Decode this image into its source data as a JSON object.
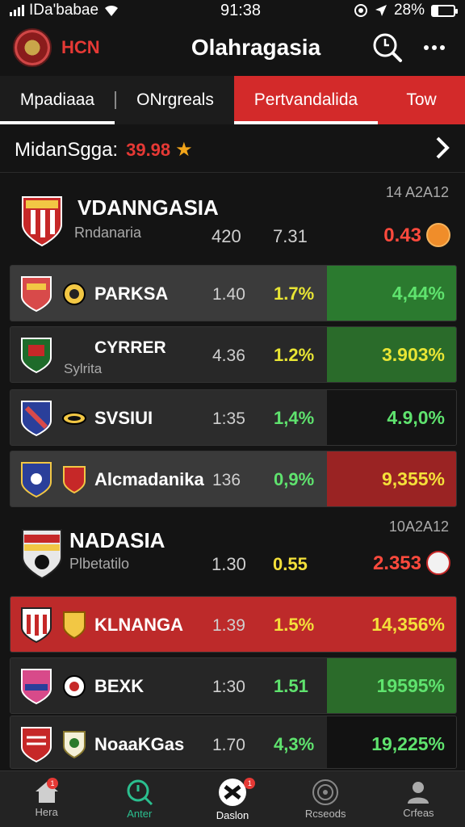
{
  "status": {
    "carrier": "IDa'babae",
    "time": "91:38",
    "battery": "28%",
    "battery_level": 0.28
  },
  "header": {
    "brand": "HCN",
    "title": "Olahragasia"
  },
  "tabs": [
    {
      "label": "Mpadiaaa",
      "active": true
    },
    {
      "label": "ONrgreals",
      "active": false
    },
    {
      "label": "Pertvandalida",
      "active": true
    },
    {
      "label": "Tow",
      "active": false
    }
  ],
  "filter": {
    "label": "MidanSgga:",
    "value": "39.98"
  },
  "groups": [
    {
      "name": "VDANNGASIA",
      "sub": "Rndanaria",
      "date": "14 A2A12",
      "c1": "420",
      "c2": "7.31",
      "c3": "0.43"
    },
    {
      "name": "NADASIA",
      "sub": "Plbetatilo",
      "date": "10A2A12",
      "c1": "1.30",
      "c2": "0.55",
      "c3": "2.353"
    }
  ],
  "rows": [
    {
      "name": "PARKSA",
      "sub": "",
      "c1": "1.40",
      "c2": "1.7%",
      "c3": "4,44%",
      "c2_color": "#e8e534",
      "c3_color": "#5fe36e",
      "left_bg": "#3b3b3b",
      "right_bg": "#2b7a2f"
    },
    {
      "name": "CYRRER",
      "sub": "Sylrita",
      "c1": "4.36",
      "c2": "1.2%",
      "c3": "3.903%",
      "c2_color": "#e8e534",
      "c3_color": "#e8e534",
      "left_bg": "#282828",
      "right_bg": "#2a6b2a"
    },
    {
      "name": "SVSIUI",
      "sub": "",
      "c1": "1:35",
      "c2": "1,4%",
      "c3": "4.9,0%",
      "c2_color": "#5fe36e",
      "c3_color": "#5fe36e",
      "left_bg": "#2c2c2c",
      "right_bg": "#141414"
    },
    {
      "name": "Alcmadanika",
      "sub": "",
      "c1": "136",
      "c2": "0,9%",
      "c3": "9,355%",
      "c2_color": "#5fe36e",
      "c3_color": "#f4e03a",
      "left_bg": "#3a3a3a",
      "right_bg": "#9a2323"
    },
    {
      "name": "KLNANGA",
      "sub": "",
      "c1": "1.39",
      "c2": "1.5%",
      "c3": "14,356%",
      "c2_color": "#f4e03a",
      "c3_color": "#f4e03a",
      "left_bg": "#bd2a2a",
      "right_bg": "#bd2a2a"
    },
    {
      "name": "BEXK",
      "sub": "",
      "c1": "1:30",
      "c2": "1.51",
      "c3": "19595%",
      "c2_color": "#5fe36e",
      "c3_color": "#5fe36e",
      "left_bg": "#262626",
      "right_bg": "#2b6b2a"
    },
    {
      "name": "NoaaKGas",
      "sub": "",
      "c1": "1.70",
      "c2": "4,3%",
      "c3": "19,225%",
      "c2_color": "#5fe36e",
      "c3_color": "#5fe36e",
      "left_bg": "#262626",
      "right_bg": "#121212"
    }
  ],
  "nav": [
    {
      "label": "Hera",
      "icon": "home-icon",
      "badge": "1"
    },
    {
      "label": "Anter",
      "icon": "clock-icon",
      "badge": ""
    },
    {
      "label": "Daslon",
      "icon": "ball-icon",
      "badge": "1"
    },
    {
      "label": "Rcseods",
      "icon": "target-icon",
      "badge": ""
    },
    {
      "label": "Crfeas",
      "icon": "user-icon",
      "badge": ""
    }
  ]
}
